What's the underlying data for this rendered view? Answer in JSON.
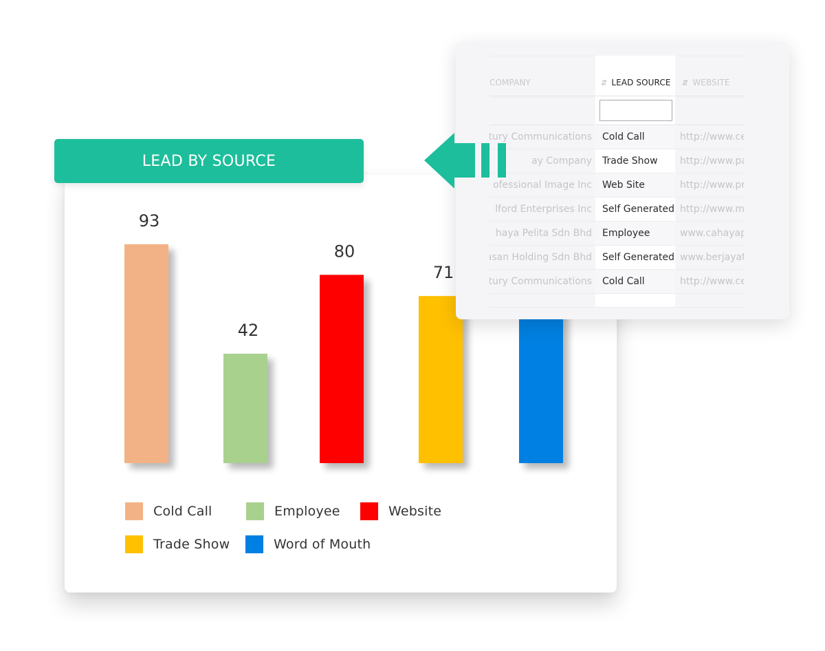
{
  "chart_data": {
    "type": "bar",
    "title": "LEAD BY SOURCE",
    "categories": [
      "Cold Call",
      "Employee",
      "Website",
      "Trade Show",
      "Word of Mouth"
    ],
    "values": [
      93,
      42,
      80,
      71,
      null
    ],
    "value_labels": [
      "93",
      "42",
      "80",
      "71",
      ""
    ],
    "colors": [
      "#f3b286",
      "#a9d18e",
      "#ff0000",
      "#ffc000",
      "#0080e2"
    ],
    "xlabel": "",
    "ylabel": "",
    "grid": false,
    "legend": {
      "placement": "bottom",
      "entries": [
        {
          "label": "Cold Call",
          "color": "#f3b286"
        },
        {
          "label": "Employee",
          "color": "#a9d18e"
        },
        {
          "label": "Website",
          "color": "#ff0000"
        },
        {
          "label": "Trade Show",
          "color": "#ffc000"
        },
        {
          "label": "Word of Mouth",
          "color": "#0080e2"
        }
      ]
    }
  },
  "chart_title": "LEAD BY SOURCE",
  "accent_color": "#1dbe9b",
  "table": {
    "columns": [
      {
        "label": "COMPANY",
        "visible_label": "OMPANY",
        "sort_icon": "sort-icon"
      },
      {
        "label": "LEAD SOURCE",
        "sort_icon": "sort-icon",
        "active": true
      },
      {
        "label": "WEBSITE",
        "sort_icon": "sort-icon"
      }
    ],
    "filter_value": "",
    "rows": [
      {
        "company": "ntury Communications",
        "source": "Cold Call",
        "website": "http://www.cer"
      },
      {
        "company": "ay Company",
        "source": "Trade Show",
        "website": "http://www.pa"
      },
      {
        "company": "ofessional Image Inc",
        "source": "Web Site",
        "website": "http://www.pro"
      },
      {
        "company": "lford Enterprises Inc",
        "source": "Self Generated",
        "website": "http://www.mi"
      },
      {
        "company": "haya Pelita Sdn Bhd",
        "source": "Employee",
        "website": "www.cahayape"
      },
      {
        "company": "yasan Holding Sdn Bhd",
        "source": "Self Generated",
        "website": "www.berjayatr"
      },
      {
        "company": "ntury Communications",
        "source": "Cold Call",
        "website": "http://www.cer"
      }
    ]
  }
}
